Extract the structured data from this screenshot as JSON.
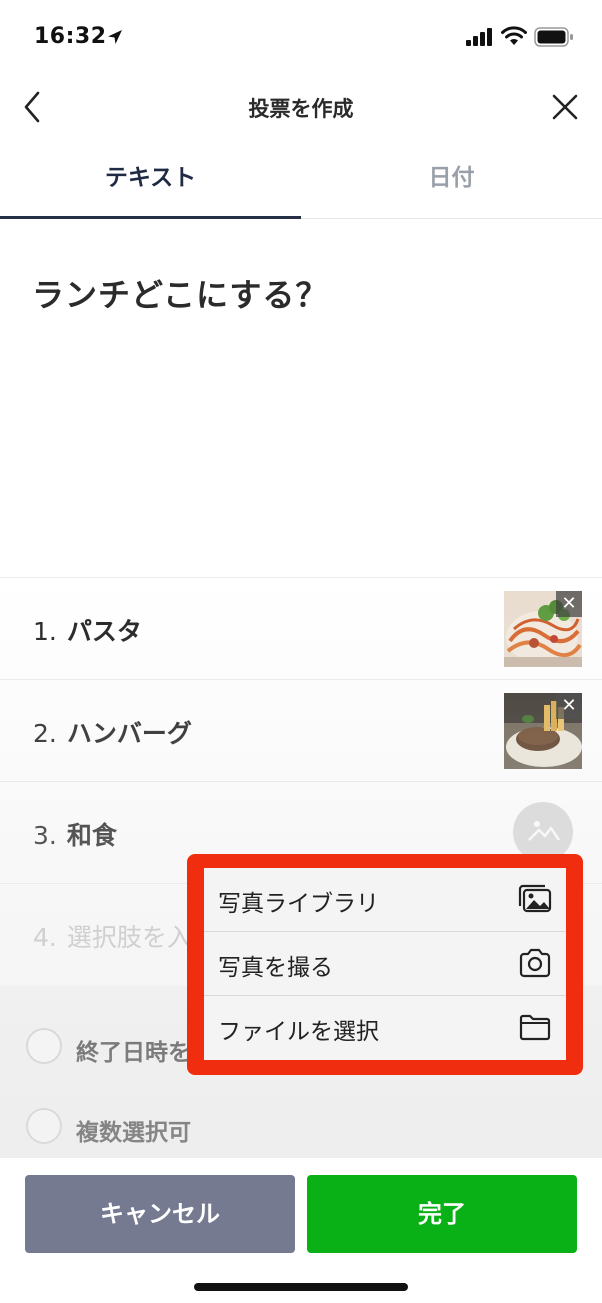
{
  "status_bar": {
    "time": "16:32",
    "icons": [
      "location-arrow-icon",
      "signal-icon",
      "wifi-icon",
      "battery-icon"
    ]
  },
  "nav": {
    "title": "投票を作成",
    "back_icon": "chevron-left-icon",
    "close_icon": "close-icon"
  },
  "tabs": [
    {
      "label": "テキスト",
      "active": true
    },
    {
      "label": "日付",
      "active": false
    }
  ],
  "question": "ランチどこにする？",
  "options": [
    {
      "number": "1.",
      "text": "パスタ",
      "has_image": true
    },
    {
      "number": "2.",
      "text": "ハンバーグ",
      "has_image": true
    },
    {
      "number": "3.",
      "text": "和食",
      "has_image": false
    },
    {
      "number": "4.",
      "text": "選択肢を入",
      "placeholder": true
    }
  ],
  "settings": [
    {
      "label": "終了日時を",
      "checked": false
    },
    {
      "label": "複数選択可",
      "checked": false
    }
  ],
  "popup_menu": {
    "items": [
      {
        "label": "写真ライブラリ",
        "icon": "photo-library-icon"
      },
      {
        "label": "写真を撮る",
        "icon": "camera-icon"
      },
      {
        "label": "ファイルを選択",
        "icon": "folder-icon"
      }
    ],
    "highlight_color": "#f12d10"
  },
  "footer": {
    "cancel_label": "キャンセル",
    "done_label": "完了"
  },
  "colors": {
    "cancel_bg": "#757a91",
    "done_bg": "#09b116",
    "active_tab": "#1f2a44"
  }
}
